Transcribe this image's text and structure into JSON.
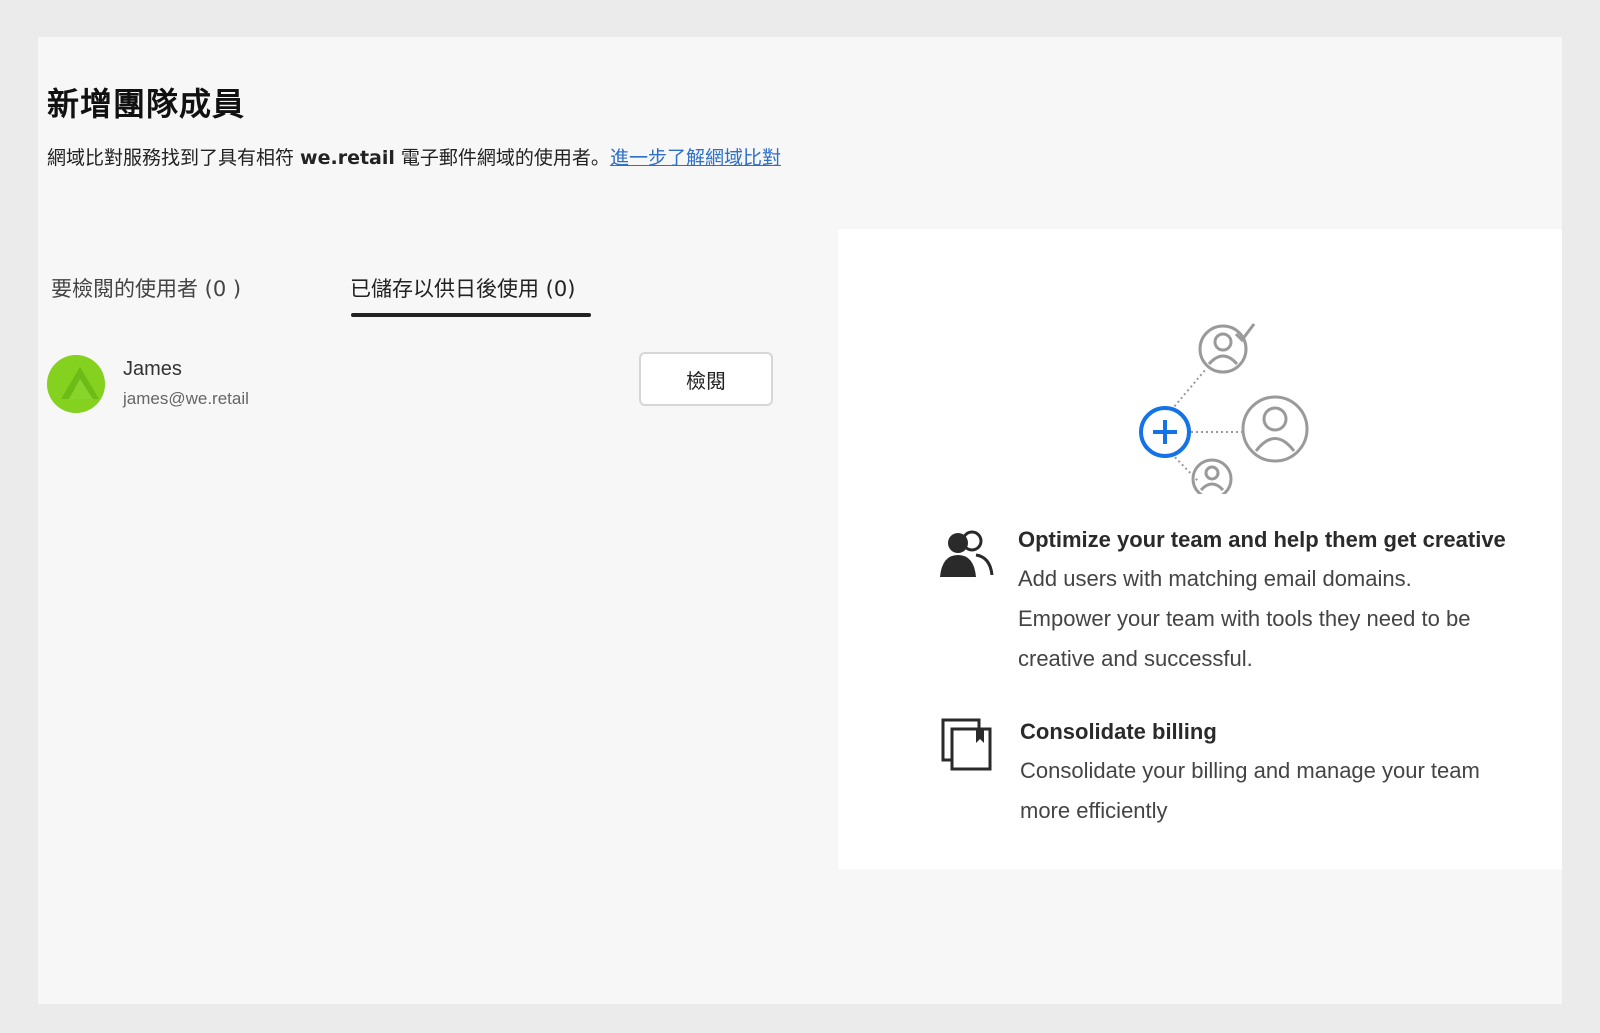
{
  "header": {
    "title": "新增團隊成員",
    "subtitle_prefix": "網域比對服務找到了具有相符 ",
    "subtitle_domain": "we.retail",
    "subtitle_suffix": " 電子郵件網域的使用者。",
    "learn_more_link": "進一步了解網域比對"
  },
  "tabs": [
    {
      "label": "要檢閱的使用者 (0 )",
      "active": false
    },
    {
      "label": "已儲存以供日後使用 (0)",
      "active": true
    }
  ],
  "users": [
    {
      "name": "James",
      "email": "james@we.retail",
      "action_label": "檢閱",
      "avatar_color": "#7dcc19"
    }
  ],
  "info_card": {
    "features": [
      {
        "icon": "users-group-icon",
        "title": "Optimize your team and help them get creative",
        "lines": [
          "Add users with matching email domains.",
          "Empower your team with tools they need to be",
          "creative and successful."
        ]
      },
      {
        "icon": "billing-stack-icon",
        "title": "Consolidate billing",
        "lines": [
          "Consolidate your billing and manage your team",
          "more efficiently"
        ]
      }
    ]
  },
  "colors": {
    "link": "#2d6fc9",
    "accent_blue": "#1473e6",
    "avatar_green": "#7dcc19",
    "panel_bg": "#f7f7f7",
    "page_bg": "#ebebeb"
  }
}
